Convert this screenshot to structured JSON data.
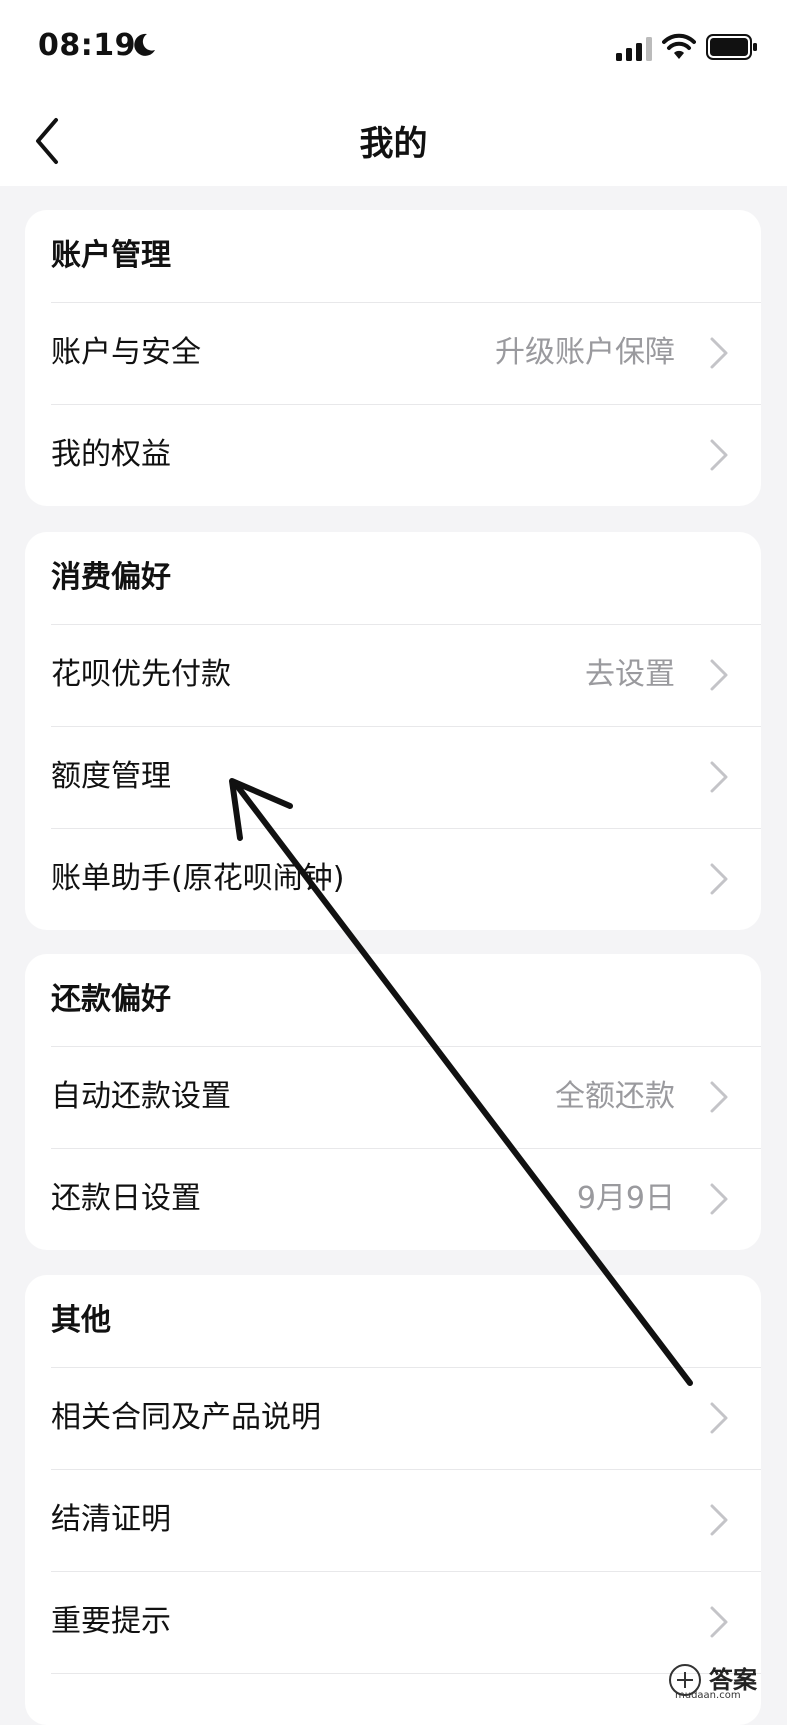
{
  "status_bar": {
    "time": "08:19"
  },
  "nav": {
    "title": "我的"
  },
  "sections": [
    {
      "header": "账户管理",
      "rows": [
        {
          "label": "账户与安全",
          "value": "升级账户保障"
        },
        {
          "label": "我的权益",
          "value": ""
        }
      ]
    },
    {
      "header": "消费偏好",
      "rows": [
        {
          "label": "花呗优先付款",
          "value": "去设置"
        },
        {
          "label": "额度管理",
          "value": ""
        },
        {
          "label": "账单助手(原花呗闹钟)",
          "value": ""
        }
      ]
    },
    {
      "header": "还款偏好",
      "rows": [
        {
          "label": "自动还款设置",
          "value": "全额还款"
        },
        {
          "label": "还款日设置",
          "value": "9月9日"
        }
      ]
    },
    {
      "header": "其他",
      "rows": [
        {
          "label": "相关合同及产品说明",
          "value": ""
        },
        {
          "label": "结清证明",
          "value": ""
        },
        {
          "label": "重要提示",
          "value": ""
        }
      ]
    }
  ],
  "watermark": {
    "text": "答案",
    "sub": "mudaan.com"
  },
  "colors": {
    "background": "#f4f4f6",
    "card": "#ffffff",
    "muted_text": "#9a9a9e",
    "divider": "#e8e8ea"
  }
}
